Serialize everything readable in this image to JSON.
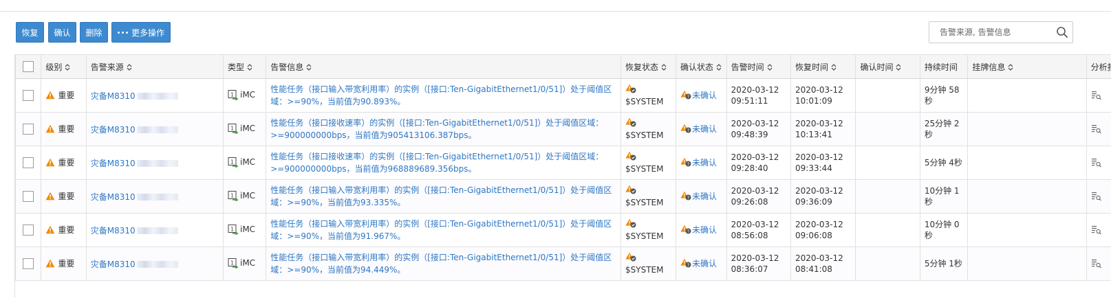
{
  "toolbar": {
    "recover_label": "恢复",
    "confirm_label": "确认",
    "delete_label": "删除",
    "more_label": "更多操作"
  },
  "search": {
    "placeholder": "告警来源, 告警信息"
  },
  "colors": {
    "accent": "#3d8ad0",
    "link": "#2d77c4",
    "warning": "#f08a00"
  },
  "table": {
    "headers": {
      "level": "级别",
      "source": "告警来源",
      "type": "类型",
      "message": "告警信息",
      "recover_status": "恢复状态",
      "confirm_status": "确认状态",
      "alarm_time": "告警时间",
      "recover_time": "恢复时间",
      "confirm_time": "确认时间",
      "duration": "持续时间",
      "tag_info": "挂牌信息",
      "analysis": "分析报"
    },
    "rows": [
      {
        "level": "重要",
        "source": "灾备M8310",
        "type": "iMC",
        "message": "性能任务（接口输入带宽利用率）的实例（[接口:Ten-GigabitEthernet1/0/51]）处于阈值区域：>=90%，当前值为90.893%。",
        "recover_status": "$SYSTEM",
        "confirm_status": "未确认",
        "alarm_date": "2020-03-12",
        "alarm_clock": "09:51:11",
        "recover_date": "2020-03-12",
        "recover_clock": "10:01:09",
        "confirm_time": "",
        "duration": "9分钟 58秒",
        "tag_info": ""
      },
      {
        "level": "重要",
        "source": "灾备M8310",
        "type": "iMC",
        "message": "性能任务（接口接收速率）的实例（[接口:Ten-GigabitEthernet1/0/51]）处于阈值区域：>=900000000bps，当前值为905413106.387bps。",
        "recover_status": "$SYSTEM",
        "confirm_status": "未确认",
        "alarm_date": "2020-03-12",
        "alarm_clock": "09:48:39",
        "recover_date": "2020-03-12",
        "recover_clock": "10:13:41",
        "confirm_time": "",
        "duration": "25分钟 2秒",
        "tag_info": ""
      },
      {
        "level": "重要",
        "source": "灾备M8310",
        "type": "iMC",
        "message": "性能任务（接口接收速率）的实例（[接口:Ten-GigabitEthernet1/0/51]）处于阈值区域：>=900000000bps，当前值为968889689.356bps。",
        "recover_status": "$SYSTEM",
        "confirm_status": "未确认",
        "alarm_date": "2020-03-12",
        "alarm_clock": "09:28:40",
        "recover_date": "2020-03-12",
        "recover_clock": "09:33:44",
        "confirm_time": "",
        "duration": "5分钟 4秒",
        "tag_info": ""
      },
      {
        "level": "重要",
        "source": "灾备M8310",
        "type": "iMC",
        "message": "性能任务（接口输入带宽利用率）的实例（[接口:Ten-GigabitEthernet1/0/51]）处于阈值区域：>=90%，当前值为93.335%。",
        "recover_status": "$SYSTEM",
        "confirm_status": "未确认",
        "alarm_date": "2020-03-12",
        "alarm_clock": "09:26:08",
        "recover_date": "2020-03-12",
        "recover_clock": "09:36:09",
        "confirm_time": "",
        "duration": "10分钟 1秒",
        "tag_info": ""
      },
      {
        "level": "重要",
        "source": "灾备M8310",
        "type": "iMC",
        "message": "性能任务（接口输入带宽利用率）的实例（[接口:Ten-GigabitEthernet1/0/51]）处于阈值区域：>=90%，当前值为91.967%。",
        "recover_status": "$SYSTEM",
        "confirm_status": "未确认",
        "alarm_date": "2020-03-12",
        "alarm_clock": "08:56:08",
        "recover_date": "2020-03-12",
        "recover_clock": "09:06:08",
        "confirm_time": "",
        "duration": "10分钟 0秒",
        "tag_info": ""
      },
      {
        "level": "重要",
        "source": "灾备M8310",
        "type": "iMC",
        "message": "性能任务（接口输入带宽利用率）的实例（[接口:Ten-GigabitEthernet1/0/51]）处于阈值区域：>=90%，当前值为94.449%。",
        "recover_status": "$SYSTEM",
        "confirm_status": "未确认",
        "alarm_date": "2020-03-12",
        "alarm_clock": "08:36:07",
        "recover_date": "2020-03-12",
        "recover_clock": "08:41:08",
        "confirm_time": "",
        "duration": "5分钟 1秒",
        "tag_info": ""
      }
    ]
  }
}
